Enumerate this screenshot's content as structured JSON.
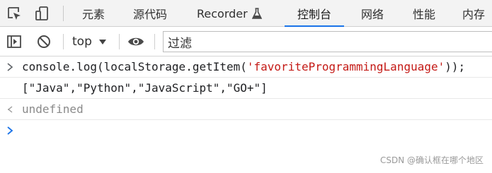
{
  "tabs": [
    {
      "label": "元素"
    },
    {
      "label": "源代码"
    },
    {
      "label": "Recorder"
    },
    {
      "label": "控制台"
    },
    {
      "label": "网络"
    },
    {
      "label": "性能"
    },
    {
      "label": "内存"
    }
  ],
  "toolbar": {
    "context": "top",
    "filter_value": "过滤"
  },
  "console": {
    "input": {
      "prefix": "console.log(localStorage.getItem(",
      "string": "'favoriteProgrammingLanguage'",
      "suffix": "));"
    },
    "output": "[\"Java\",\"Python\",\"JavaScript\",\"GO+\"]",
    "result": "undefined"
  },
  "watermark": "CSDN @确认框在哪个地区",
  "colors": {
    "accent": "#1a73e8",
    "string": "#c41a16",
    "prompt": "#1a73e8"
  }
}
